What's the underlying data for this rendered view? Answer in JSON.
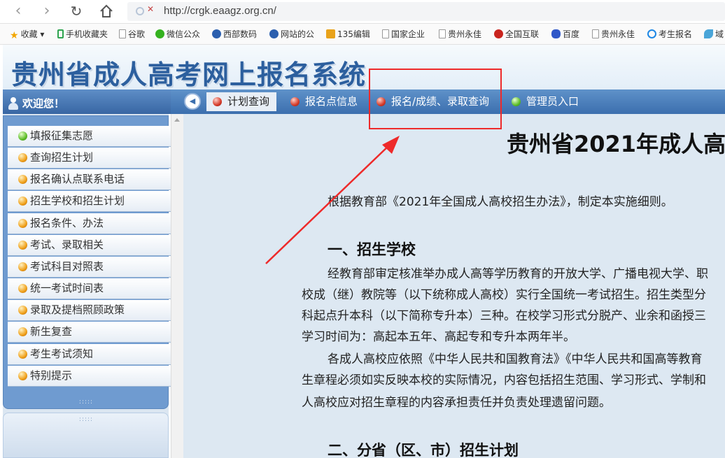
{
  "browser": {
    "url": "http://crgk.eaagz.org.cn/",
    "back_icon": "chevron-left-icon",
    "forward_icon": "chevron-right-icon",
    "reload_icon": "reload-icon",
    "home_icon": "home-icon"
  },
  "bookmarks": [
    {
      "label": "收藏",
      "icon": "star-icon"
    },
    {
      "label": "手机收藏夹",
      "icon": "phone-icon"
    },
    {
      "label": "谷歌",
      "icon": "doc-icon"
    },
    {
      "label": "微信公众",
      "icon": "wechat-icon"
    },
    {
      "label": "西部数码",
      "icon": "globe-icon"
    },
    {
      "label": "网站的公",
      "icon": "globe-icon"
    },
    {
      "label": "135编辑",
      "icon": "editor-icon"
    },
    {
      "label": "国家企业",
      "icon": "doc-icon"
    },
    {
      "label": "贵州永佳",
      "icon": "doc-icon"
    },
    {
      "label": "全国互联",
      "icon": "emblem-icon"
    },
    {
      "label": "百度",
      "icon": "baidu-paw-icon"
    },
    {
      "label": "贵州永佳",
      "icon": "doc-icon"
    },
    {
      "label": "考生报名",
      "icon": "ring-icon"
    },
    {
      "label": "域",
      "icon": "leaf-icon"
    }
  ],
  "header": {
    "title": "贵州省成人高考网上报名系统"
  },
  "nav": {
    "welcome": "欢迎您！",
    "items": [
      {
        "label": "计划查询",
        "active": true
      },
      {
        "label": "报名点信息",
        "active": false
      },
      {
        "label": "报名/成绩、录取查询",
        "active": false
      },
      {
        "label": "管理员入口",
        "active": false
      }
    ]
  },
  "sidebar": {
    "items": [
      {
        "label": "填报征集志愿",
        "status": "green"
      },
      {
        "label": "查询招生计划",
        "status": "orange"
      },
      {
        "label": "报名确认点联系电话",
        "status": "orange"
      },
      {
        "label": "招生学校和招生计划",
        "status": "orange"
      },
      {
        "label": "报名条件、办法",
        "status": "orange"
      },
      {
        "label": "考试、录取相关",
        "status": "orange"
      },
      {
        "label": "考试科目对照表",
        "status": "orange"
      },
      {
        "label": "统一考试时间表",
        "status": "orange"
      },
      {
        "label": "录取及提档照顾政策",
        "status": "orange"
      },
      {
        "label": "新生复查",
        "status": "orange"
      },
      {
        "label": "考生考试须知",
        "status": "orange"
      },
      {
        "label": "特别提示",
        "status": "orange"
      }
    ]
  },
  "content": {
    "title": "贵州省2021年成人高",
    "intro": "根据教育部《2021年全国成人高校招生办法》，制定本实施细则。",
    "section1_heading": "一、招生学校",
    "section1_lines": [
      "经教育部审定核准举办成人高等学历教育的开放大学、广播电视大学、职",
      "校成（继）教院等（以下统称成人高校）实行全国统一考试招生。招生类型分",
      "科起点升本科（以下简称专升本）三种。在校学习形式分脱产、业余和函授三",
      "学习时间为：高起本五年、高起专和专升本两年半。",
      "各成人高校应依照《中华人民共和国教育法》《中华人民共和国高等教育",
      "生章程必须如实反映本校的实际情况，内容包括招生范围、学习形式、学制和",
      "人高校应对招生章程的内容承担责任并负责处理遗留问题。"
    ],
    "section2_heading": "二、分省（区、市）招生计划"
  },
  "colors": {
    "brand_blue": "#2c5f9e",
    "nav_blue": "#3c6fae",
    "annotation_red": "#ee2a2a",
    "content_bg": "#dde8f2"
  }
}
